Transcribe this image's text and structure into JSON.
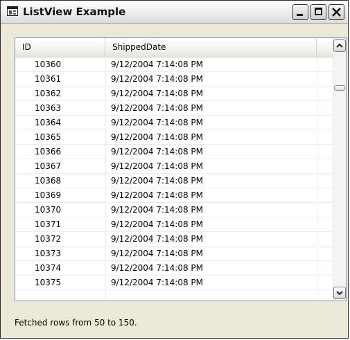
{
  "window": {
    "title": "ListView Example"
  },
  "listview": {
    "columns": [
      "ID",
      "ShippedDate"
    ],
    "rows": [
      {
        "id": "10360",
        "shipped": "9/12/2004 7:14:08 PM"
      },
      {
        "id": "10361",
        "shipped": "9/12/2004 7:14:08 PM"
      },
      {
        "id": "10362",
        "shipped": "9/12/2004 7:14:08 PM"
      },
      {
        "id": "10363",
        "shipped": "9/12/2004 7:14:08 PM"
      },
      {
        "id": "10364",
        "shipped": "9/12/2004 7:14:08 PM"
      },
      {
        "id": "10365",
        "shipped": "9/12/2004 7:14:08 PM"
      },
      {
        "id": "10366",
        "shipped": "9/12/2004 7:14:08 PM"
      },
      {
        "id": "10367",
        "shipped": "9/12/2004 7:14:08 PM"
      },
      {
        "id": "10368",
        "shipped": "9/12/2004 7:14:08 PM"
      },
      {
        "id": "10369",
        "shipped": "9/12/2004 7:14:08 PM"
      },
      {
        "id": "10370",
        "shipped": "9/12/2004 7:14:08 PM"
      },
      {
        "id": "10371",
        "shipped": "9/12/2004 7:14:08 PM"
      },
      {
        "id": "10372",
        "shipped": "9/12/2004 7:14:08 PM"
      },
      {
        "id": "10373",
        "shipped": "9/12/2004 7:14:08 PM"
      },
      {
        "id": "10374",
        "shipped": "9/12/2004 7:14:08 PM"
      },
      {
        "id": "10375",
        "shipped": "9/12/2004 7:14:08 PM"
      }
    ]
  },
  "status": {
    "text": "Fetched rows from 50 to 150."
  },
  "icons": {
    "app": "listview-app-icon",
    "minimize": "minimize-icon",
    "maximize": "maximize-icon",
    "close": "close-icon",
    "scroll_up": "chevron-up-icon",
    "scroll_down": "chevron-down-icon"
  },
  "colors": {
    "window_bg": "#ece9d8",
    "list_border": "#7f9db9"
  }
}
